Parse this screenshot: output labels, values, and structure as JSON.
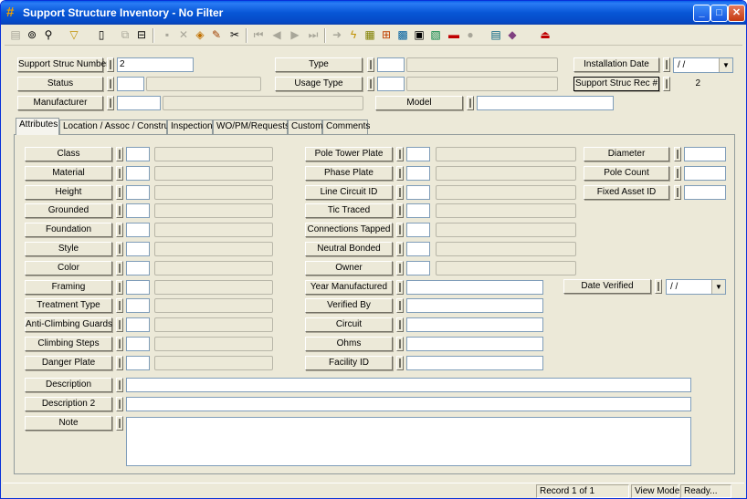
{
  "window": {
    "title": "Support Structure Inventory - No Filter",
    "app_icon": "hash-icon"
  },
  "title_buttons": {
    "minimize": "_",
    "maximize": "□",
    "close": "✕"
  },
  "toolbar_icons": [
    "nav-icon",
    "binoculars-icon",
    "search-icon",
    "filter-icon",
    "new-record-icon",
    "copy-icon",
    "open-icon",
    "save-icon",
    "delete-icon",
    "stack-icon",
    "edit-icon",
    "cut-icon",
    "first-icon",
    "prev-icon",
    "next-icon",
    "last-icon",
    "goto-icon",
    "lightning-icon",
    "report-icon",
    "tree-icon",
    "map-icon",
    "calendar-icon",
    "gis-icon",
    "truck-icon",
    "globe-icon",
    "chart-icon",
    "book-icon",
    "exit-icon"
  ],
  "header": {
    "support_struc_number_label": "Support Struc Number",
    "support_struc_number_value": "2",
    "type_label": "Type",
    "installation_date_label": "Installation Date",
    "installation_date_value": "/ /",
    "status_label": "Status",
    "usage_type_label": "Usage Type",
    "rec_label": "Support Struc Rec #",
    "rec_value": "2",
    "manufacturer_label": "Manufacturer",
    "model_label": "Model"
  },
  "tabs": [
    {
      "label": "Attributes"
    },
    {
      "label": "Location / Assoc / Construct"
    },
    {
      "label": "Inspection"
    },
    {
      "label": "WO/PM/Requests"
    },
    {
      "label": "Custom"
    },
    {
      "label": "Comments"
    }
  ],
  "attributes": {
    "col1": [
      "Class",
      "Material",
      "Height",
      "Grounded",
      "Foundation",
      "Style",
      "Color",
      "Framing",
      "Treatment Type",
      "Anti-Climbing Guards",
      "Climbing Steps",
      "Danger Plate"
    ],
    "col2": [
      "Pole Tower Plate",
      "Phase Plate",
      "Line Circuit ID",
      "Tic Traced",
      "Connections Tapped",
      "Neutral Bonded",
      "Owner",
      "Year Manufactured",
      "Verified By",
      "Circuit",
      "Ohms",
      "Facility ID"
    ],
    "col3": [
      "Diameter",
      "Pole Count",
      "Fixed Asset ID"
    ],
    "date_verified_label": "Date Verified",
    "date_verified_value": "/ /",
    "description_label": "Description",
    "description2_label": "Description 2",
    "note_label": "Note"
  },
  "statusbar": {
    "record": "Record 1 of 1",
    "mode": "View Mode",
    "state": "Ready..."
  }
}
